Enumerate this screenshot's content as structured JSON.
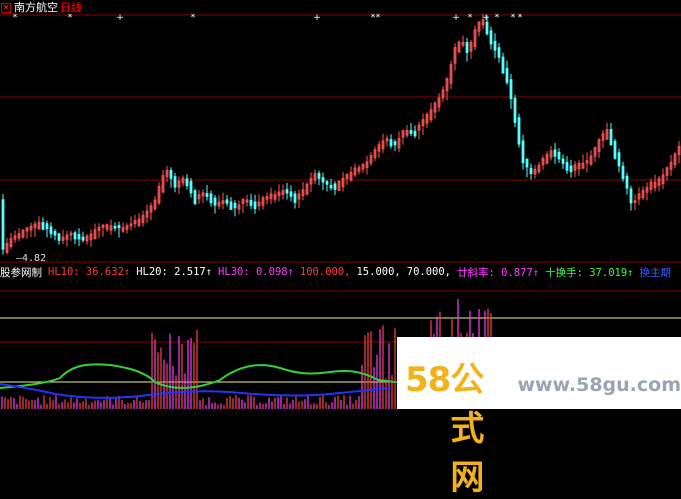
{
  "window": {
    "stock_name": "南方航空",
    "period": "日线",
    "close_icon": "close-x-icon"
  },
  "low_price_label": "—4.82",
  "indicator_bar": {
    "name": "股参网制",
    "items": [
      {
        "text": "HL10: 36.632↑",
        "color": "#ff3b3b"
      },
      {
        "text": "HL20: 2.517↑",
        "color": "#ffffff"
      },
      {
        "text": "HL30: 0.098↑",
        "color": "#ff3bff"
      },
      {
        "text": "100.000,",
        "color": "#ff3b3b"
      },
      {
        "text": "15.000,",
        "color": "#ffffff"
      },
      {
        "text": "70.000,",
        "color": "#ffffff"
      },
      {
        "text": "廿斜率: 0.877↑",
        "color": "#ff3bff"
      },
      {
        "text": "十换手: 37.019↑",
        "color": "#3bff3b"
      },
      {
        "text": "换主期",
        "color": "#3b5bff"
      }
    ]
  },
  "watermark": {
    "logo_num": "58",
    "logo_text": "公式网",
    "url": "www.58gu.com"
  },
  "colors": {
    "up": "#ff5555",
    "down": "#54ffff",
    "grid": "#8b0000",
    "hl_green": "#34d134",
    "hl_blue": "#2233ff",
    "hl_yellow": "#f0f080"
  }
}
